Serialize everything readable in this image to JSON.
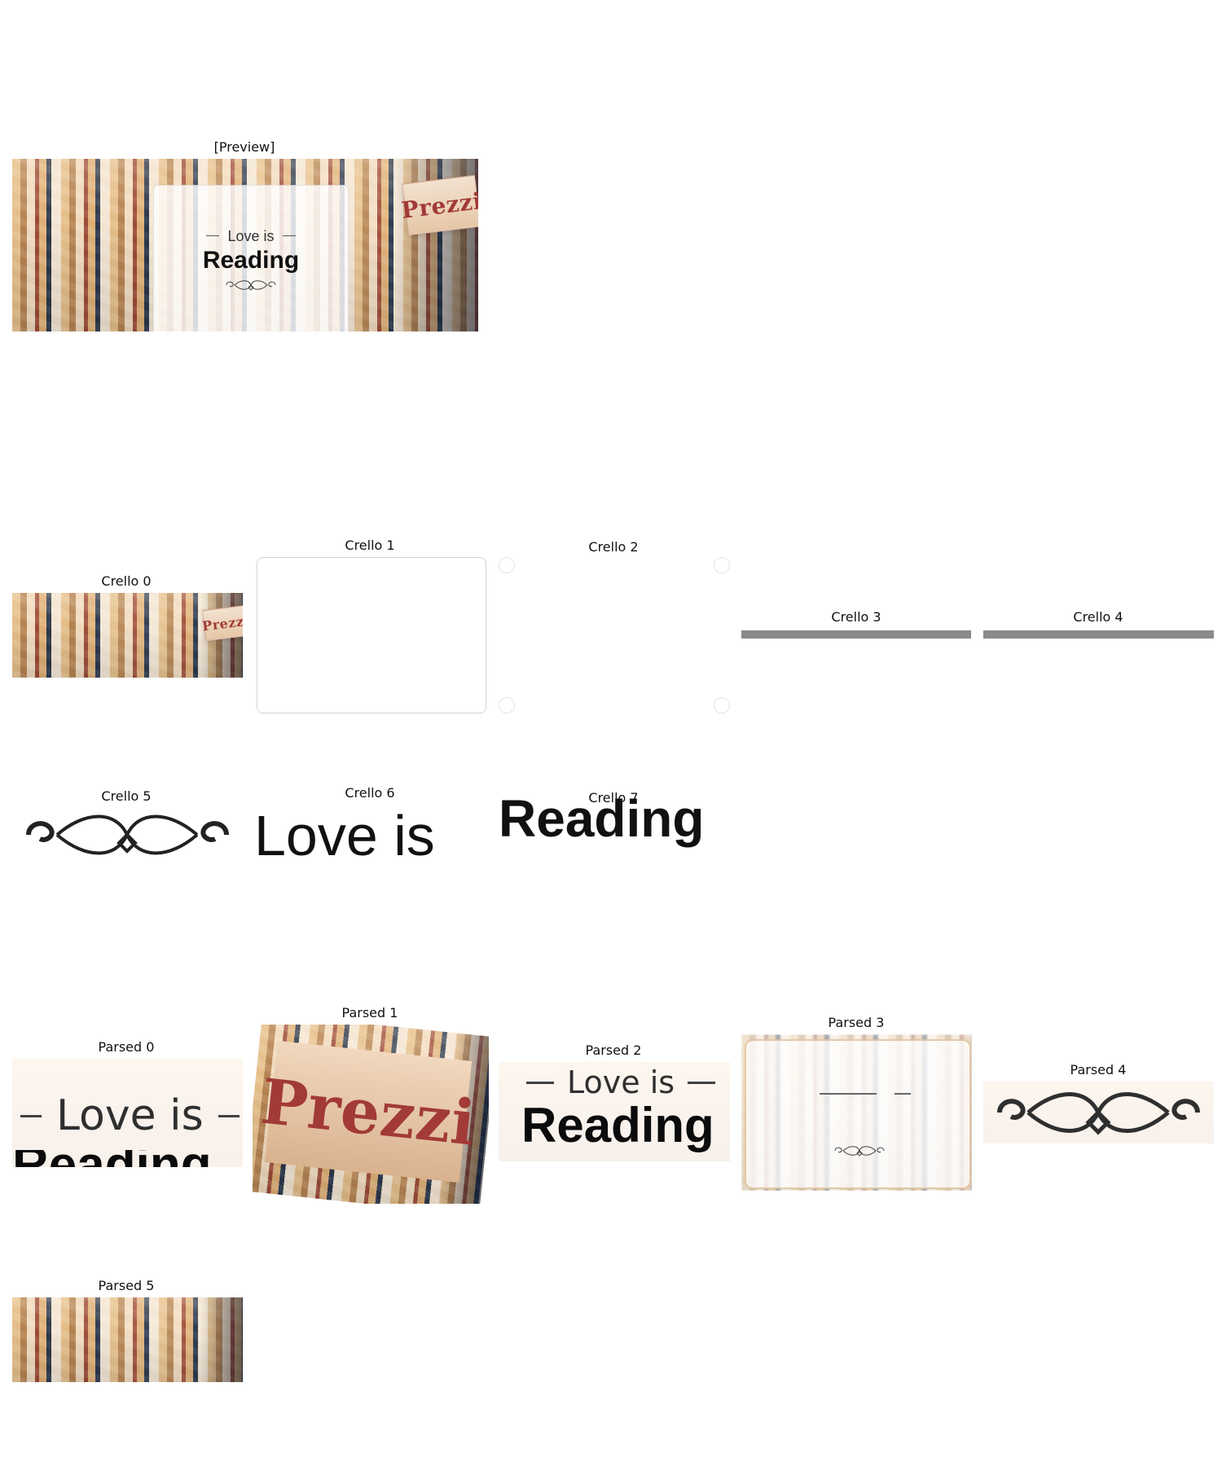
{
  "labels": {
    "preview": "[Preview]",
    "crello_0": "Crello 0",
    "crello_1": "Crello 1",
    "crello_2": "Crello 2",
    "crello_3": "Crello 3",
    "crello_4": "Crello 4",
    "crello_5": "Crello 5",
    "crello_6": "Crello 6",
    "crello_7": "Crello 7",
    "parsed_0": "Parsed 0",
    "parsed_1": "Parsed 1",
    "parsed_2": "Parsed 2",
    "parsed_3": "Parsed 3",
    "parsed_4": "Parsed 4",
    "parsed_5": "Parsed 5"
  },
  "text": {
    "love_is": "Love is",
    "reading": "Reading",
    "prezzi": "Prezzi"
  },
  "icons": {
    "ornament": "flourish-icon"
  }
}
